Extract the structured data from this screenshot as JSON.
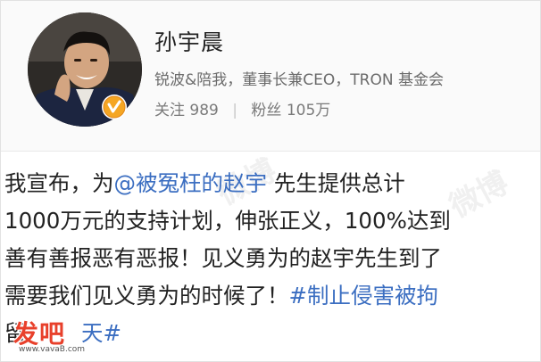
{
  "profile": {
    "name": "孙宇晨",
    "bio": "锐波&陪我，董事长兼CEO，TRON 基金会",
    "following_label": "关注",
    "following_count": "989",
    "followers_label": "粉丝",
    "followers_count": "105万",
    "verified_color": "#f5a623"
  },
  "post": {
    "l1_a": "我宣布，为",
    "l1_mention": "@被冤枉的赵宇",
    "l1_b": " 先生提供总计",
    "l2": "1000万元的支持计划，伸张正义，100%达到",
    "l3": "善有善报恶有恶报！见义勇为的赵宇先生到了",
    "l4_a": "需要我们见义勇为的时候了！",
    "l4_tag": "#制止侵害被拘",
    "l5_a": "留",
    "l5_tag": "天#"
  },
  "watermarks": {
    "a": "微博",
    "b": "微博"
  },
  "logo": {
    "main": "发吧",
    "sub": "www.vavaB.com"
  },
  "colors": {
    "link": "#3b6ec1",
    "logo": "#e8402b"
  }
}
